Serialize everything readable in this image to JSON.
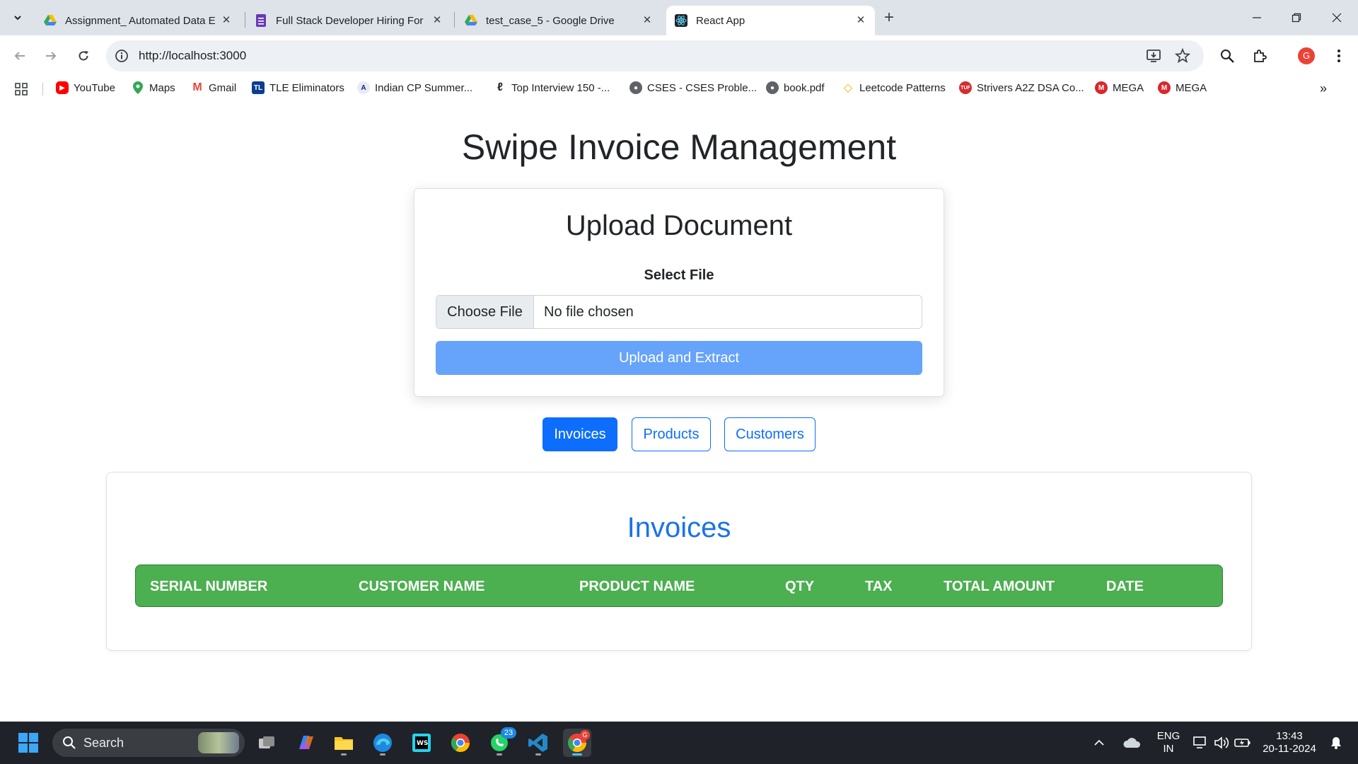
{
  "browser": {
    "tabs": [
      {
        "title": "Assignment_ Automated Data E",
        "icon": "google-drive-icon"
      },
      {
        "title": "Full Stack Developer Hiring For",
        "icon": "google-forms-icon"
      },
      {
        "title": "test_case_5 - Google Drive",
        "icon": "google-drive-icon"
      },
      {
        "title": "React App",
        "icon": "react-icon",
        "active": true
      }
    ],
    "url": "http://localhost:3000",
    "profile_initial": "G",
    "bookmarks": [
      {
        "label": "YouTube",
        "icon": "youtube-icon",
        "color": "#ff0000"
      },
      {
        "label": "Maps",
        "icon": "maps-icon",
        "color": "#34a853"
      },
      {
        "label": "Gmail",
        "icon": "gmail-icon",
        "color": "#ea4335"
      },
      {
        "label": "TLE Eliminators",
        "icon": "tle-icon",
        "color": "#0b3d91"
      },
      {
        "label": "Indian CP Summer...",
        "icon": "cp-icon",
        "color": "#1a237e"
      },
      {
        "label": "Top Interview 150 -...",
        "icon": "leetcode-icon",
        "color": "#ffa116"
      },
      {
        "label": "CSES - CSES Proble...",
        "icon": "globe-icon",
        "color": "#5f6368"
      },
      {
        "label": "book.pdf",
        "icon": "globe-icon",
        "color": "#5f6368"
      },
      {
        "label": "Leetcode Patterns",
        "icon": "leetcode-patterns-icon",
        "color": "#f4b400"
      },
      {
        "label": "Strivers A2Z DSA Co...",
        "icon": "tuf-icon",
        "color": "#d32f2f"
      },
      {
        "label": "MEGA",
        "icon": "mega-icon",
        "color": "#d9272e"
      },
      {
        "label": "MEGA",
        "icon": "mega-icon",
        "color": "#d9272e"
      }
    ]
  },
  "app": {
    "title": "Swipe Invoice Management",
    "upload": {
      "title": "Upload Document",
      "select_label": "Select File",
      "choose_button": "Choose File",
      "file_status": "No file chosen",
      "submit_button": "Upload and Extract"
    },
    "nav_tabs": [
      {
        "label": "Invoices",
        "active": true
      },
      {
        "label": "Products",
        "active": false
      },
      {
        "label": "Customers",
        "active": false
      }
    ],
    "table": {
      "title": "Invoices",
      "header_color": "#4caf50",
      "columns": [
        "SERIAL NUMBER",
        "CUSTOMER NAME",
        "PRODUCT NAME",
        "QTY",
        "TAX",
        "TOTAL AMOUNT",
        "DATE"
      ],
      "rows": []
    }
  },
  "taskbar": {
    "search_placeholder": "Search",
    "whatsapp_badge": "23",
    "chrome_badge": "G",
    "language": "ENG",
    "region": "IN",
    "time": "13:43",
    "date": "20-11-2024"
  },
  "colors": {
    "primary": "#0d6efd",
    "upload_button": "#66a3fb",
    "table_title": "#1a73e8"
  }
}
